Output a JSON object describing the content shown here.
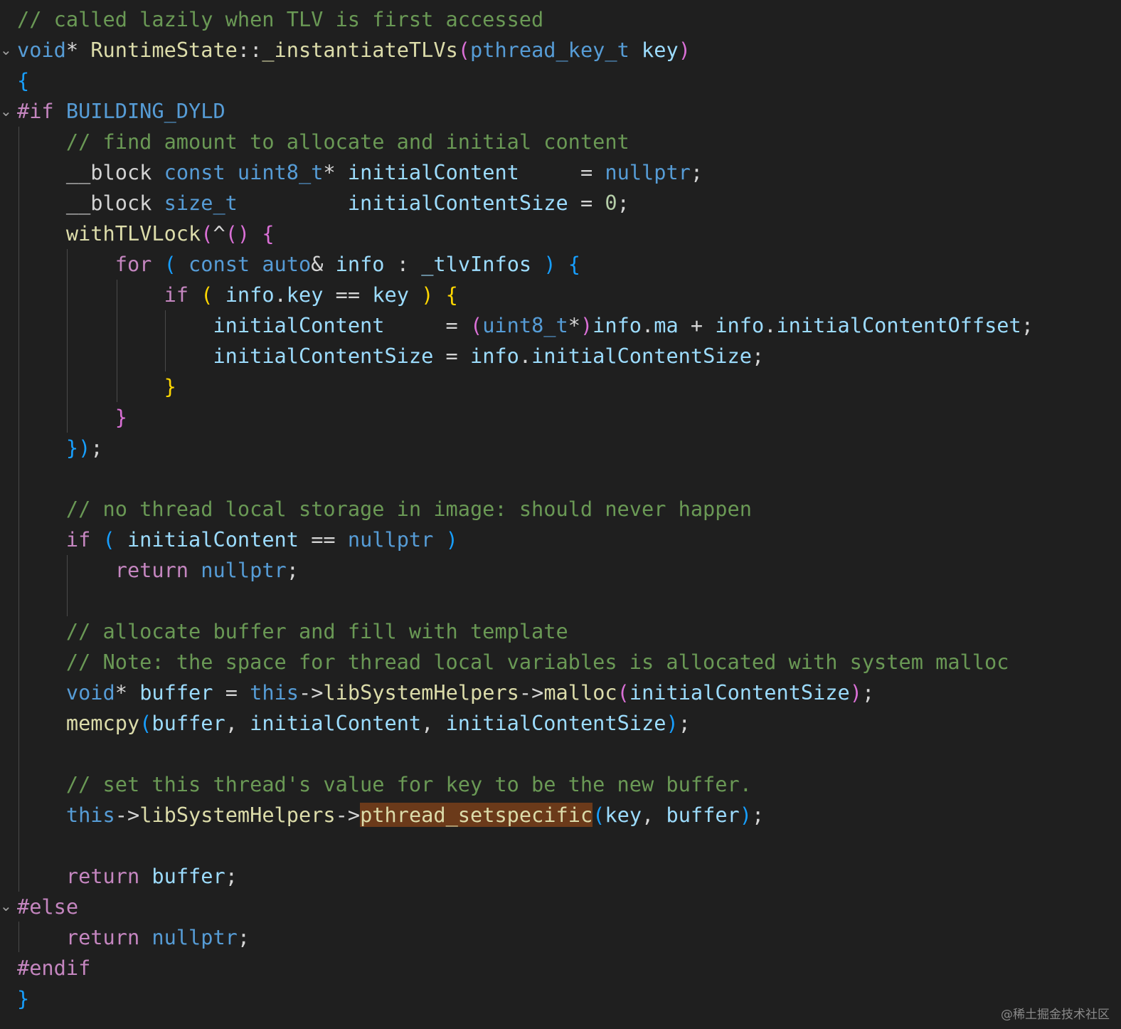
{
  "code_lines": [
    "// called lazily when TLV is first accessed",
    "void* RuntimeState::_instantiateTLVs(pthread_key_t key)",
    "{",
    "#if BUILDING_DYLD",
    "    // find amount to allocate and initial content",
    "    __block const uint8_t* initialContent     = nullptr;",
    "    __block size_t         initialContentSize = 0;",
    "    withTLVLock(^() {",
    "        for ( const auto& info : _tlvInfos ) {",
    "            if ( info.key == key ) {",
    "                initialContent     = (uint8_t*)info.ma + info.initialContentOffset;",
    "                initialContentSize = info.initialContentSize;",
    "            }",
    "        }",
    "    });",
    "",
    "    // no thread local storage in image: should never happen",
    "    if ( initialContent == nullptr )",
    "        return nullptr;",
    "",
    "    // allocate buffer and fill with template",
    "    // Note: the space for thread local variables is allocated with system malloc",
    "    void* buffer = this->libSystemHelpers->malloc(initialContentSize);",
    "    memcpy(buffer, initialContent, initialContentSize);",
    "",
    "    // set this thread's value for key to be the new buffer.",
    "    this->libSystemHelpers->pthread_setspecific(key, buffer);",
    "",
    "    return buffer;",
    "#else",
    "    return nullptr;",
    "#endif",
    "}"
  ],
  "folding": {
    "glyph": "⌄",
    "folded_lines": [
      1,
      3,
      29
    ]
  },
  "highlight": {
    "line": 26,
    "token": "pthread_setspecific",
    "color": "#6b3a1a"
  },
  "watermark": "@稀土掘金技术社区",
  "theme": {
    "background": "#1f1f1f",
    "comment": "#6a9955",
    "keyword": "#569cd6",
    "control": "#c586c0",
    "function": "#dcdcaa",
    "variable": "#9cdcfe",
    "number": "#b5cea8"
  }
}
